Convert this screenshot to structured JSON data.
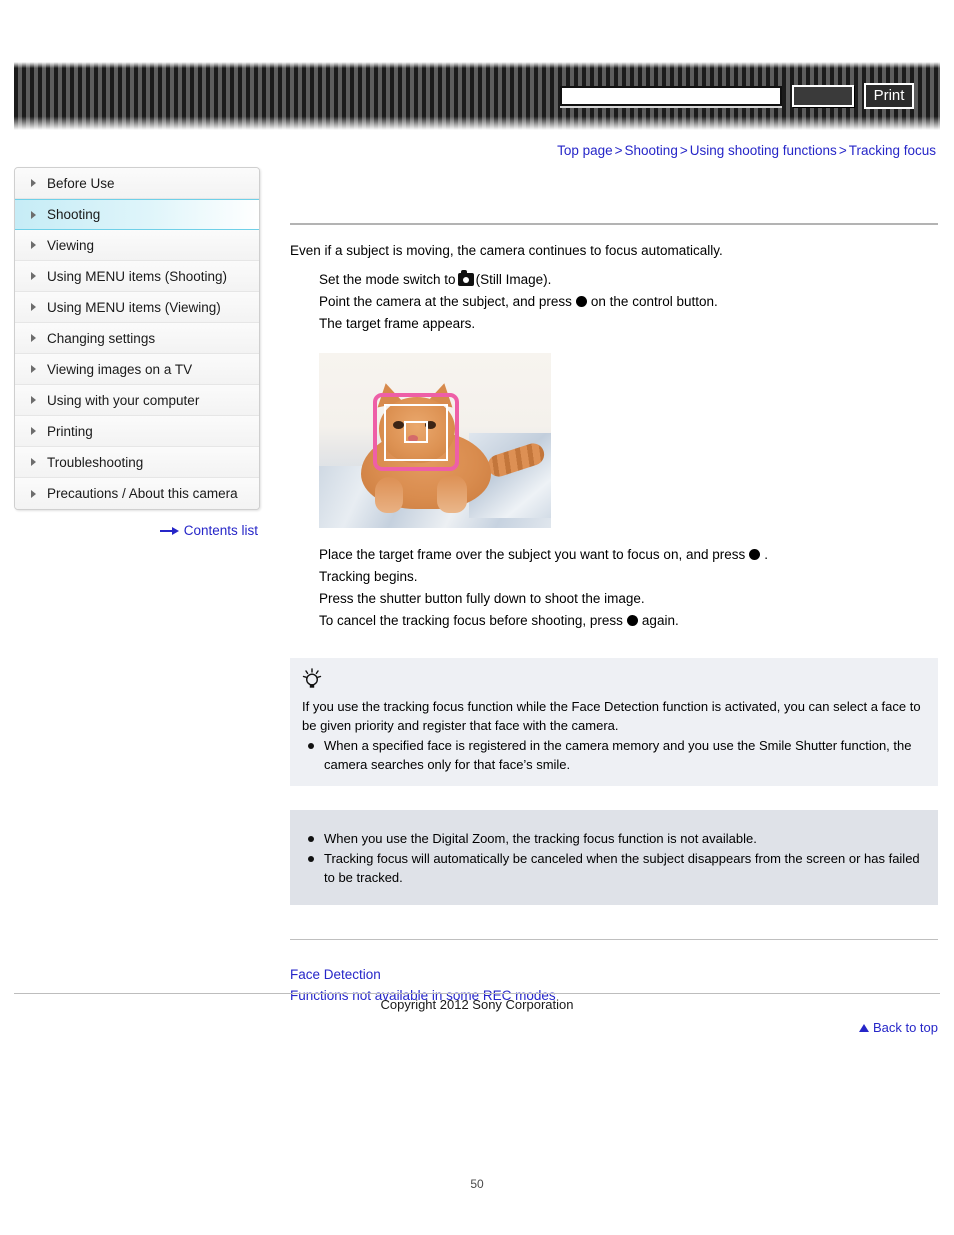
{
  "header": {
    "search_value": "",
    "search_placeholder": "",
    "search_button_label": "",
    "print_button_label": "Print"
  },
  "breadcrumb": {
    "items": [
      "Top page",
      "Shooting",
      "Using shooting functions",
      "Tracking focus"
    ],
    "separator": ">"
  },
  "sidebar": {
    "items": [
      {
        "label": "Before Use",
        "active": false
      },
      {
        "label": "Shooting",
        "active": true
      },
      {
        "label": "Viewing",
        "active": false
      },
      {
        "label": "Using MENU items (Shooting)",
        "active": false
      },
      {
        "label": "Using MENU items (Viewing)",
        "active": false
      },
      {
        "label": "Changing settings",
        "active": false
      },
      {
        "label": "Viewing images on a TV",
        "active": false
      },
      {
        "label": "Using with your computer",
        "active": false
      },
      {
        "label": "Printing",
        "active": false
      },
      {
        "label": "Troubleshooting",
        "active": false
      },
      {
        "label": "Precautions / About this camera",
        "active": false
      }
    ],
    "contents_list_label": "Contents list"
  },
  "main": {
    "title": "",
    "intro": "Even if a subject is moving, the camera continues to focus automatically.",
    "steps": [
      {
        "before": "Set the mode switch to",
        "icon": "camera-icon",
        "after": "(Still Image)."
      },
      {
        "before": "Point the camera at the subject, and press",
        "icon": "control-button-dot-icon",
        "after": "on the control button."
      },
      {
        "before": "The target frame appears.",
        "icon": "",
        "after": ""
      }
    ],
    "steps_after_image": [
      {
        "before": "Place the target frame over the subject you want to focus on, and press",
        "icon": "control-button-dot-icon",
        "after": "."
      },
      {
        "before": "Tracking begins.",
        "icon": "",
        "after": ""
      },
      {
        "before": "Press the shutter button fully down to shoot the image.",
        "icon": "",
        "after": ""
      },
      {
        "before": "To cancel the tracking focus before shooting, press",
        "icon": "control-button-dot-icon",
        "after": "again."
      }
    ],
    "photo_alt": "Camera screen showing an orange tabby cat with a pink tracking frame over its face",
    "tip": {
      "icon": "lightbulb-tip-icon",
      "text": "If you use the tracking focus function while the Face Detection function is activated, you can select a face to be given priority and register that face with the camera.",
      "bullets": [
        "When a specified face is registered in the camera memory and you use the Smile Shutter function, the camera searches only for that face’s smile."
      ]
    },
    "note": {
      "bullets": [
        "When you use the Digital Zoom, the tracking focus function is not available.",
        "Tracking focus will automatically be canceled when the subject disappears from the screen or has failed to be tracked."
      ]
    },
    "related_links": [
      "Face Detection",
      "Functions not available in some REC modes"
    ],
    "back_to_top_label": "Back to top"
  },
  "footer": {
    "copyright": "Copyright 2012 Sony Corporation",
    "page_number": "50"
  },
  "colors": {
    "link": "#2626c8",
    "sidebar_active": "#c6ecf6",
    "tip_bg": "#eef0f4",
    "note_bg": "#dfe2e8",
    "tracking_frame": "#ee5fa7"
  }
}
